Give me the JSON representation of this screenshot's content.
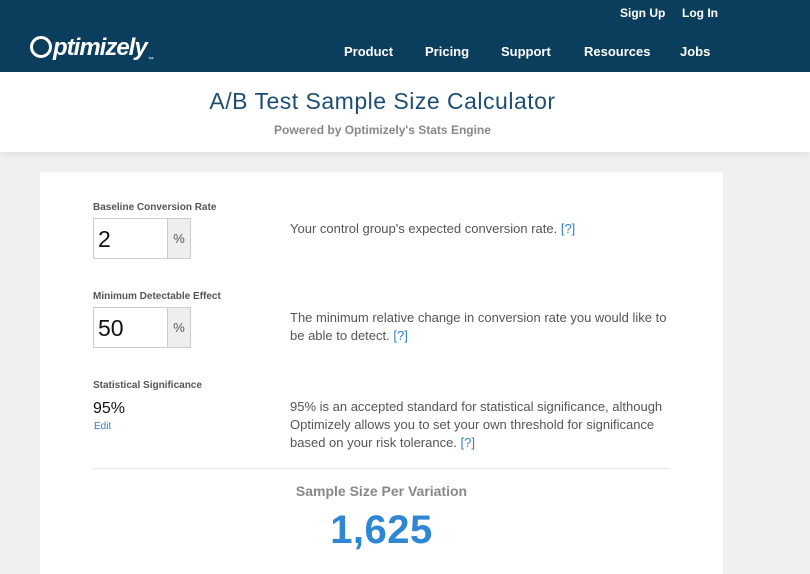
{
  "header": {
    "logo_text": "ptimizely",
    "logo_tm": "™",
    "util_links": [
      "Sign Up",
      "Log In"
    ],
    "nav": [
      "Product",
      "Pricing",
      "Support",
      "Resources",
      "Jobs"
    ],
    "bg_color": "#0b3e5d"
  },
  "hero": {
    "title": "A/B Test Sample Size Calculator",
    "subtitle": "Powered by Optimizely's Stats Engine"
  },
  "calculator": {
    "baseline": {
      "label": "Baseline Conversion Rate",
      "value": "2",
      "unit": "%",
      "description": "Your control group's expected conversion rate. ",
      "help": "[?]"
    },
    "mde": {
      "label": "Minimum Detectable Effect",
      "value": "50",
      "unit": "%",
      "description": "The minimum relative change in conversion rate you would like to be able to detect. ",
      "help": "[?]"
    },
    "significance": {
      "label": "Statistical Significance",
      "value": "95%",
      "edit_label": "Edit",
      "description": "95% is an accepted standard for statistical significance, although Optimizely allows you to set your own threshold for significance based on your risk tolerance. ",
      "help": "[?]"
    },
    "result": {
      "label": "Sample Size Per Variation",
      "value": "1,625"
    },
    "accent_color": "#2f86d4"
  }
}
